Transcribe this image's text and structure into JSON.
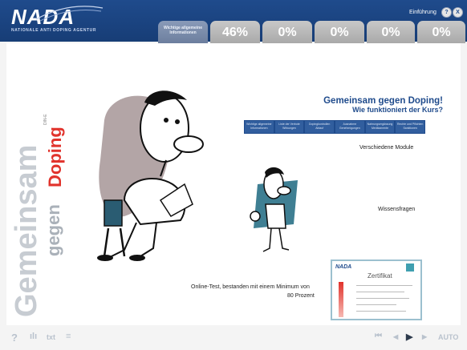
{
  "header": {
    "logo_text": "NADA",
    "logo_subtitle": "NATIONALE ANTI DOPING AGENTUR",
    "intro_label": "Einführung",
    "intro_button_1": "?",
    "intro_button_2": "X",
    "tabs": [
      {
        "label": "Wichtige allgemeine Informationen"
      },
      {
        "label": "46%"
      },
      {
        "label": "0%"
      },
      {
        "label": "0%"
      },
      {
        "label": "0%"
      },
      {
        "label": "0%"
      }
    ]
  },
  "side_title": {
    "line1": "Gemeinsam",
    "line2": "gegen",
    "line3": "Doping",
    "small": "DIN-E"
  },
  "main": {
    "title": "Gemeinsam gegen Doping!",
    "subtitle": "Wie funktioniert der Kurs?",
    "modules": [
      {
        "label": "Wichtige allgemeine Informationen"
      },
      {
        "label": "Liste der Verbote Wirkungen"
      },
      {
        "label": "Dopingkontrollen Ablauf"
      },
      {
        "label": "Ausnahme Genehmigungen"
      },
      {
        "label": "Nahrungsergänzung Medikamente"
      },
      {
        "label": "Rechte und Pflichten Sanktionen"
      }
    ],
    "label_modules": "Verschiedene Module",
    "label_questions": "Wissensfragen",
    "label_test_line1": "Online-Test, bestanden mit einem Minimum von",
    "label_test_line2": "80 Prozent",
    "certificate_title": "Zertifikat",
    "certificate_logo": "NADA"
  },
  "footer": {
    "help": "?",
    "stats": "ılı",
    "txt": "txt",
    "menu": "≡",
    "first": "⏮",
    "prev": "◀",
    "play": "▶",
    "next": "▶",
    "auto": "AUTO"
  },
  "colors": {
    "brand_blue": "#1f4b8c",
    "accent_red": "#e1332c",
    "tab_gray": "#b5b5b5"
  }
}
